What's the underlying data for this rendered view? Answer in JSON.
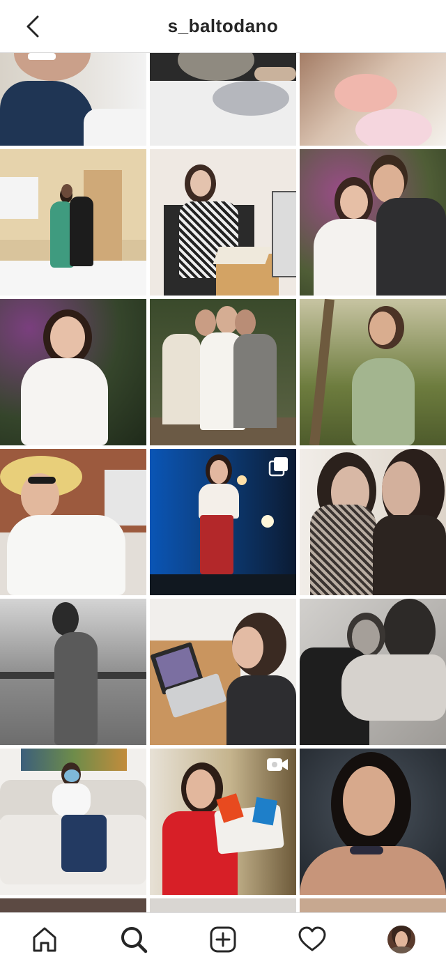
{
  "header": {
    "title": "s_baltodano"
  },
  "accent": "#262626",
  "grid": {
    "tiles": [
      {
        "id": "r1c1",
        "badge": ""
      },
      {
        "id": "r1c2",
        "badge": ""
      },
      {
        "id": "r1c3",
        "badge": ""
      },
      {
        "id": "r2c1",
        "badge": ""
      },
      {
        "id": "r2c2",
        "badge": ""
      },
      {
        "id": "r2c3",
        "badge": ""
      },
      {
        "id": "r3c1",
        "badge": ""
      },
      {
        "id": "r3c2",
        "badge": ""
      },
      {
        "id": "r3c3",
        "badge": ""
      },
      {
        "id": "r4c1",
        "badge": ""
      },
      {
        "id": "r4c2",
        "badge": "carousel-icon"
      },
      {
        "id": "r4c3",
        "badge": ""
      },
      {
        "id": "r5c1",
        "badge": ""
      },
      {
        "id": "r5c2",
        "badge": ""
      },
      {
        "id": "r5c3",
        "badge": ""
      },
      {
        "id": "r6c1",
        "badge": ""
      },
      {
        "id": "r6c2",
        "badge": "video-icon"
      },
      {
        "id": "r6c3",
        "badge": ""
      }
    ]
  },
  "tabbar": {
    "items": [
      {
        "name": "home",
        "icon": "home-icon"
      },
      {
        "name": "search",
        "icon": "search-icon",
        "active": true
      },
      {
        "name": "new-post",
        "icon": "plus-square-icon"
      },
      {
        "name": "activity",
        "icon": "heart-icon"
      },
      {
        "name": "profile",
        "icon": "profile-avatar"
      }
    ]
  }
}
